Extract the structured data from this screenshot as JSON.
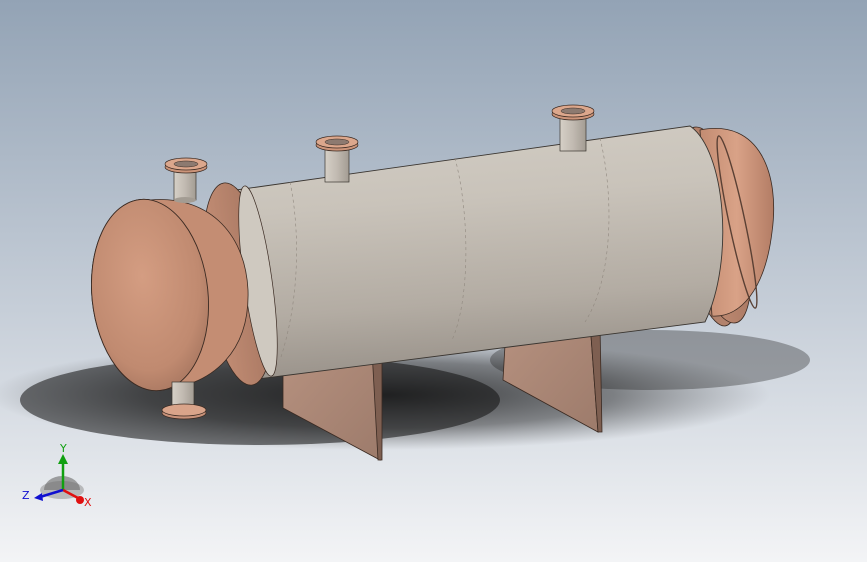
{
  "viewport": {
    "background_top": "#93a3b5",
    "background_bottom": "#f2f3f5"
  },
  "model": {
    "shell_color": "#c7c1b7",
    "head_color": "#c8957a",
    "support_color": "#b08c7c",
    "nozzle_color": "#c7c1b7",
    "flange_color": "#d09a80"
  },
  "triad": {
    "x_label": "X",
    "y_label": "Y",
    "z_label": "Z",
    "x_color": "#e01010",
    "y_color": "#10a010",
    "z_color": "#1010d0"
  }
}
